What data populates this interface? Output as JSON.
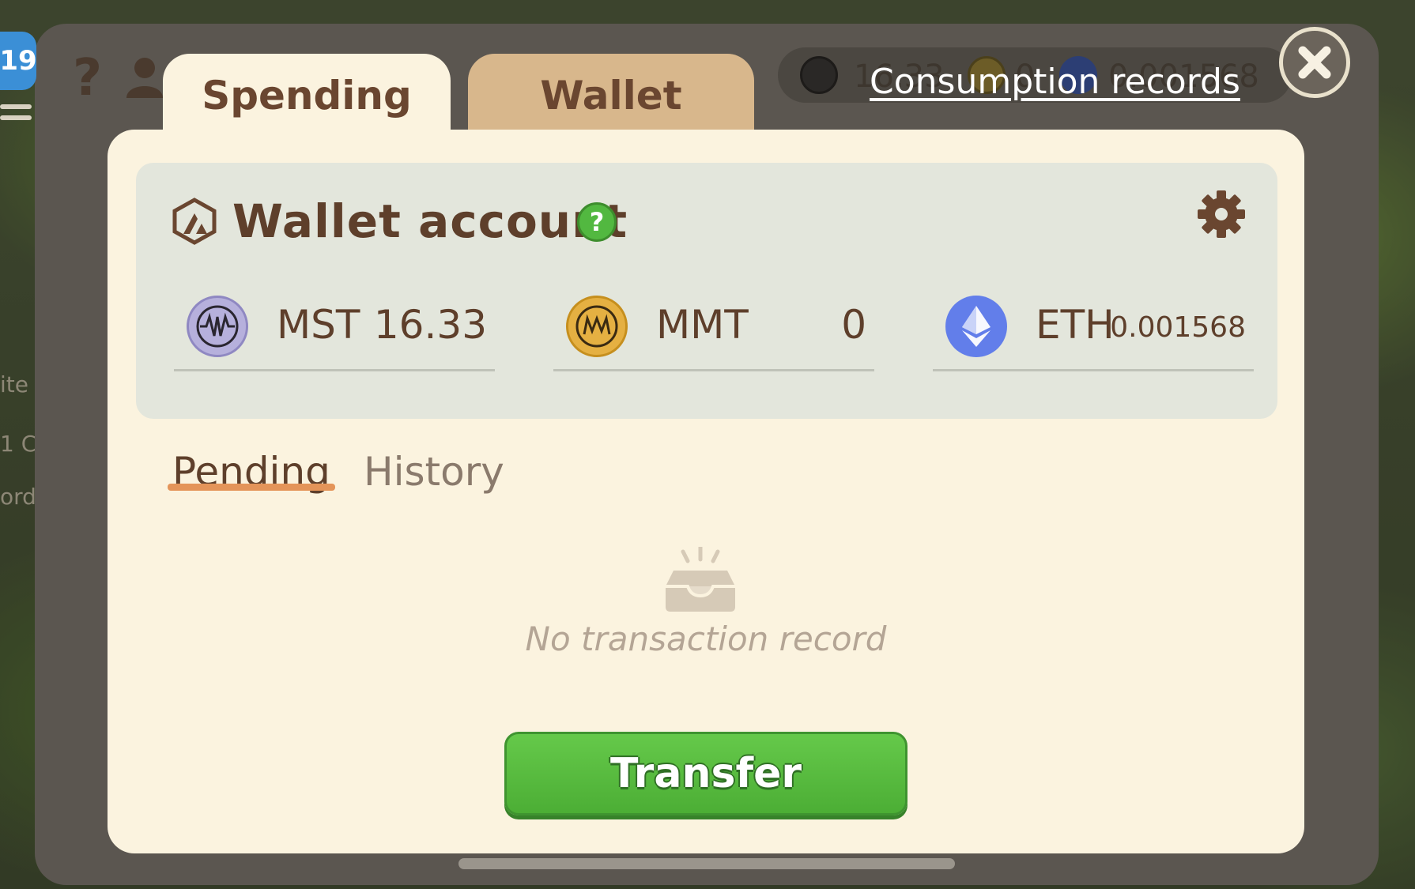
{
  "header": {
    "level": "19",
    "strip": {
      "mst_value": "16.33",
      "mmt_value": "0",
      "eth_value": "0.001568"
    },
    "consumption_link": "Consumption records"
  },
  "tabs": [
    {
      "label": "Spending",
      "active": true
    },
    {
      "label": "Wallet",
      "active": false
    }
  ],
  "wallet": {
    "title": "Wallet account",
    "help": "?",
    "tokens": [
      {
        "symbol": "MST",
        "amount": "16.33",
        "icon": "mst-coin-icon",
        "color": "#b6b0dc"
      },
      {
        "symbol": "MMT",
        "amount": "0",
        "icon": "mmt-coin-icon",
        "color": "#e5b042"
      },
      {
        "symbol": "ETH",
        "amount": "0.001568",
        "icon": "eth-icon",
        "color": "#627eea"
      }
    ]
  },
  "subtabs": [
    {
      "label": "Pending",
      "active": true
    },
    {
      "label": "History",
      "active": false
    }
  ],
  "empty_state": "No transaction record",
  "transfer_button": "Transfer",
  "side_text": [
    "ite",
    "1 C",
    "ord"
  ],
  "colors": {
    "accent_green": "#52b840",
    "card_bg": "#fbf3df",
    "title_brown": "#5e3f2b",
    "underline_orange": "#e49459"
  }
}
